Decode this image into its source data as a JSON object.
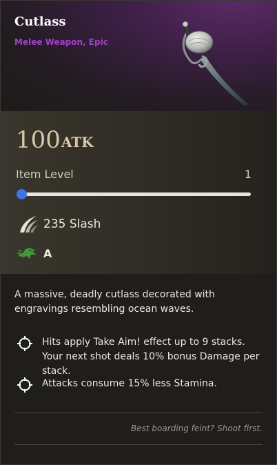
{
  "item": {
    "name": "Cutlass",
    "category": "Melee Weapon, Epic",
    "art_icon": "cutlass-icon"
  },
  "stats": {
    "atk_value": "100",
    "atk_label": "ATK",
    "item_level_label": "Item Level",
    "item_level_value": "1",
    "item_level_slider": 0,
    "damage_icon": "slash-icon",
    "damage_text": "235 Slash",
    "scaling_icon": "dexterity-icon",
    "scaling_grade": "A"
  },
  "description": "A massive, deadly cutlass decorated with engravings resembling ocean waves.",
  "perks": [
    {
      "icon": "crosshair-icon",
      "text": "Hits apply Take Aim! effect up to 9 stacks. Your next shot deals 10% bonus Damage per stack."
    },
    {
      "icon": "crosshair-icon",
      "text": "Attacks consume 15% less Stamina."
    }
  ],
  "flavor_text": "Best boarding feint? Shoot first.",
  "colors": {
    "rarity_epic": "#a040c8",
    "atk": "#d7c9a7",
    "slider_accent": "#3d6fe0"
  }
}
